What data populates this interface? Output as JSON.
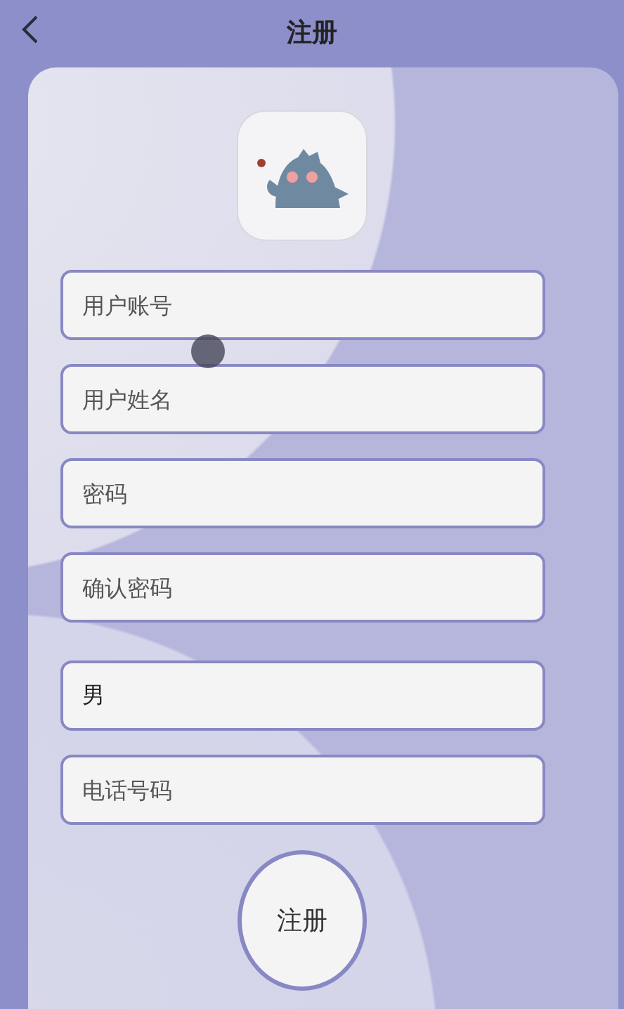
{
  "header": {
    "title": "注册"
  },
  "fields": [
    {
      "placeholder": "用户账号"
    },
    {
      "placeholder": "用户姓名"
    },
    {
      "placeholder": "密码"
    },
    {
      "placeholder": "确认密码"
    },
    {
      "value": "男",
      "kind": "select"
    },
    {
      "placeholder": "电话号码"
    }
  ],
  "submit_button": "注册"
}
